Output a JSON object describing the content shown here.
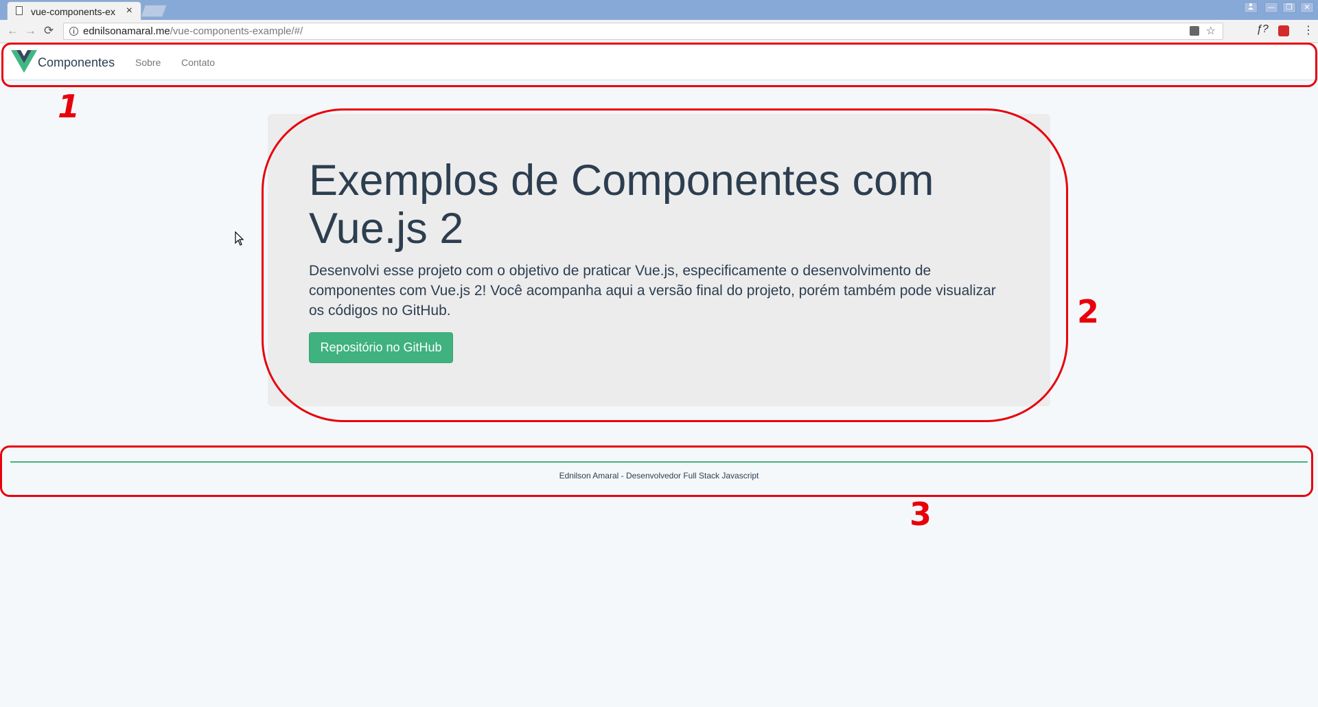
{
  "browser": {
    "tab_title": "vue-components-ex",
    "tab_close": "×",
    "url_domain": "ednilsonamaral.me",
    "url_path": "/vue-components-example/#/",
    "ext_label": "ƒ?",
    "winctl": [
      "—",
      "❐",
      "✕"
    ]
  },
  "navbar": {
    "brand": "Componentes",
    "links": [
      "Sobre",
      "Contato"
    ]
  },
  "jumbotron": {
    "title": "Exemplos de Componentes com Vue.js 2",
    "text": "Desenvolvi esse projeto com o objetivo de praticar Vue.js, especificamente o desenvolvimento de componentes com Vue.js 2! Você acompanha aqui a versão final do projeto, porém também pode visualizar os códigos no GitHub.",
    "button": "Repositório no GitHub"
  },
  "footer": {
    "text": "Ednilson Amaral - Desenvolvedor Full Stack Javascript"
  },
  "annotations": [
    "1",
    "2",
    "3"
  ],
  "colors": {
    "accent": "#3fb27f",
    "annotation": "#e8000b",
    "text": "#2c3e50"
  }
}
